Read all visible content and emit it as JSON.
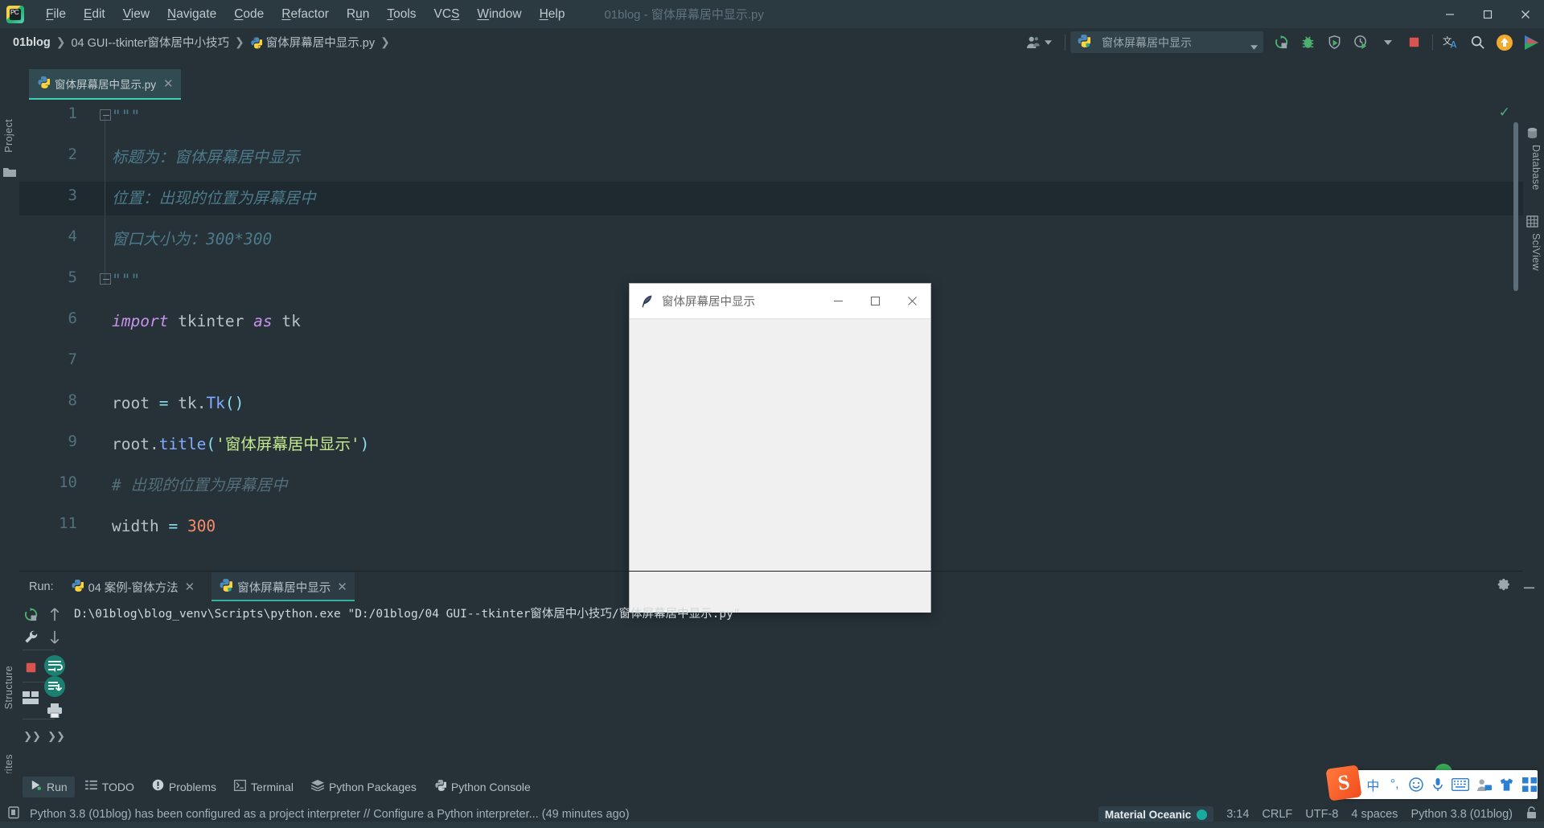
{
  "window": {
    "title": "01blog - 窗体屏幕居中显示.py",
    "minimize": "—",
    "maximize": "□",
    "close": "✕"
  },
  "menubar": {
    "items": [
      {
        "label": "File",
        "mnemonic": "F"
      },
      {
        "label": "Edit",
        "mnemonic": "E"
      },
      {
        "label": "View",
        "mnemonic": "V"
      },
      {
        "label": "Navigate",
        "mnemonic": "N"
      },
      {
        "label": "Code",
        "mnemonic": "C"
      },
      {
        "label": "Refactor",
        "mnemonic": "R"
      },
      {
        "label": "Run",
        "mnemonic": "u"
      },
      {
        "label": "Tools",
        "mnemonic": "T"
      },
      {
        "label": "VCS",
        "mnemonic": "S"
      },
      {
        "label": "Window",
        "mnemonic": "W"
      },
      {
        "label": "Help",
        "mnemonic": "H"
      }
    ]
  },
  "breadcrumb": {
    "separator": "❯",
    "items": [
      "01blog",
      "04 GUI--tkinter窗体居中小技巧",
      "窗体屏幕居中显示.py"
    ]
  },
  "toolbar": {
    "run_config": "窗体屏幕居中显示",
    "icons": [
      "rerun-icon",
      "debug-icon",
      "run-coverage-icon",
      "profile-icon",
      "dropdown-icon",
      "stop-icon",
      "translate-icon",
      "search-everywhere-icon",
      "update-icon",
      "play-colored-icon"
    ]
  },
  "left_strip": {
    "project": "Project",
    "structure": "Structure",
    "favorites": "Favorites"
  },
  "right_strip": {
    "database": "Database",
    "sciview": "SciView"
  },
  "editor_tab": {
    "label": "窗体屏幕居中显示.py",
    "close": "✕"
  },
  "editor": {
    "lines": [
      {
        "n": "1",
        "tokens": [
          {
            "t": "\"\"\"",
            "c": "doc"
          }
        ]
      },
      {
        "n": "2",
        "tokens": [
          {
            "t": "标题为：窗体屏幕居中显示",
            "c": "doc"
          }
        ]
      },
      {
        "n": "3",
        "tokens": [
          {
            "t": "位置：出现的位置为屏幕居中",
            "c": "doc"
          }
        ]
      },
      {
        "n": "4",
        "tokens": [
          {
            "t": "窗口大小为：300*300",
            "c": "doc"
          }
        ]
      },
      {
        "n": "5",
        "tokens": [
          {
            "t": "\"\"\"",
            "c": "doc"
          }
        ]
      },
      {
        "n": "6",
        "tokens": [
          {
            "t": "import",
            "c": "kw"
          },
          {
            "t": " tkinter ",
            "c": "plain"
          },
          {
            "t": "as",
            "c": "kw"
          },
          {
            "t": " tk",
            "c": "plain"
          }
        ]
      },
      {
        "n": "7",
        "tokens": []
      },
      {
        "n": "8",
        "tokens": [
          {
            "t": "root ",
            "c": "plain"
          },
          {
            "t": "=",
            "c": "op"
          },
          {
            "t": " tk",
            "c": "plain"
          },
          {
            "t": ".",
            "c": "plain"
          },
          {
            "t": "Tk",
            "c": "cls"
          },
          {
            "t": "()",
            "c": "paren"
          }
        ]
      },
      {
        "n": "9",
        "tokens": [
          {
            "t": "root",
            "c": "plain"
          },
          {
            "t": ".",
            "c": "plain"
          },
          {
            "t": "title",
            "c": "fn"
          },
          {
            "t": "(",
            "c": "paren"
          },
          {
            "t": "'窗体屏幕居中显示'",
            "c": "str"
          },
          {
            "t": ")",
            "c": "paren"
          }
        ]
      },
      {
        "n": "10",
        "tokens": [
          {
            "t": "# 出现的位置为屏幕居中",
            "c": "cmt"
          }
        ]
      },
      {
        "n": "11",
        "tokens": [
          {
            "t": "width ",
            "c": "plain"
          },
          {
            "t": "=",
            "c": "op"
          },
          {
            "t": " ",
            "c": "plain"
          },
          {
            "t": "300",
            "c": "num"
          }
        ]
      }
    ],
    "highlighted_line": "3"
  },
  "tk_window": {
    "title": "窗体屏幕居中显示",
    "icon": "feather-icon",
    "minimize": "—",
    "maximize": "□",
    "close": "✕"
  },
  "run_panel": {
    "label": "Run:",
    "tabs": [
      {
        "label": "04 案例-窗体方法",
        "active": false,
        "close": "✕"
      },
      {
        "label": "窗体屏幕居中显示",
        "active": true,
        "close": "✕"
      }
    ],
    "console": "D:\\01blog\\blog_venv\\Scripts\\python.exe \"D:/01blog/04 GUI--tkinter窗体居中小技巧/窗体屏幕居中显示.py\"",
    "sidebar_icons": [
      "rerun-icon",
      "scroll-up-icon",
      "settings-wrench-icon",
      "scroll-down-icon",
      "stop-icon",
      "soft-wrap-icon",
      "layout-icon",
      "scroll-to-end-icon",
      "print-icon"
    ],
    "expand_left": "❯❯",
    "expand_right": "❯❯",
    "settings_icon": "gear-icon",
    "hide_icon": "minimize-icon"
  },
  "bottom_bar": {
    "items": [
      {
        "label": "Run",
        "icon": "run-icon",
        "active": true
      },
      {
        "label": "TODO",
        "icon": "todo-icon",
        "active": false
      },
      {
        "label": "Problems",
        "icon": "problems-icon",
        "active": false
      },
      {
        "label": "Terminal",
        "icon": "terminal-icon",
        "active": false
      },
      {
        "label": "Python Packages",
        "icon": "packages-icon",
        "active": false
      },
      {
        "label": "Python Console",
        "icon": "python-console-icon",
        "active": false
      }
    ]
  },
  "status_bar": {
    "message": "Python 3.8 (01blog) has been configured as a project interpreter // Configure a Python interpreter... (49 minutes ago)",
    "message_icon": "notification-icon",
    "theme": "Material Oceanic",
    "caret": "3:14",
    "line_separator": "CRLF",
    "encoding": "UTF-8",
    "indent": "4 spaces",
    "interpreter": "Python 3.8 (01blog)",
    "lock_icon": "lock-icon"
  },
  "ime": {
    "logo": "S",
    "items": [
      "中",
      "°,",
      "☺",
      "🎤",
      "⌨",
      "👤",
      "👕",
      "▦"
    ]
  },
  "colors": {
    "background": "#263238",
    "titlebar": "#2b3940",
    "accent_teal": "#3ecfb2",
    "string_green": "#c3e88d",
    "keyword_purple": "#c792ea",
    "number_orange": "#f78c6c",
    "class_blue": "#82aaff",
    "comment_gray": "#546e7a",
    "stop_red": "#d9534f"
  }
}
